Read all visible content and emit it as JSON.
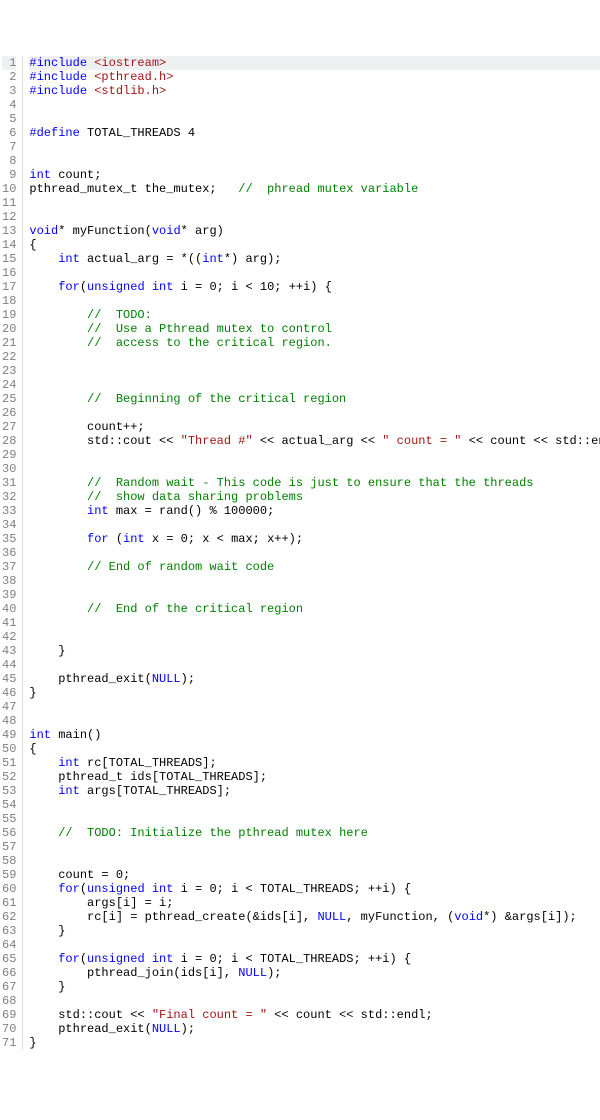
{
  "editor": {
    "currentLine": 1,
    "lines": [
      {
        "num": 1,
        "tokens": [
          {
            "cls": "pp",
            "t": "#include "
          },
          {
            "cls": "s",
            "t": "<iostream>"
          }
        ]
      },
      {
        "num": 2,
        "tokens": [
          {
            "cls": "pp",
            "t": "#include "
          },
          {
            "cls": "s",
            "t": "<pthread.h>"
          }
        ]
      },
      {
        "num": 3,
        "tokens": [
          {
            "cls": "pp",
            "t": "#include "
          },
          {
            "cls": "s",
            "t": "<stdlib.h>"
          }
        ]
      },
      {
        "num": 4,
        "tokens": []
      },
      {
        "num": 5,
        "tokens": []
      },
      {
        "num": 6,
        "tokens": [
          {
            "cls": "pp",
            "t": "#define "
          },
          {
            "cls": "n",
            "t": "TOTAL_THREADS "
          },
          {
            "cls": "m",
            "t": "4"
          }
        ]
      },
      {
        "num": 7,
        "tokens": []
      },
      {
        "num": 8,
        "tokens": []
      },
      {
        "num": 9,
        "tokens": [
          {
            "cls": "k",
            "t": "int"
          },
          {
            "cls": "n",
            "t": " count;"
          }
        ]
      },
      {
        "num": 10,
        "tokens": [
          {
            "cls": "n",
            "t": "pthread_mutex_t the_mutex;   "
          },
          {
            "cls": "c",
            "t": "//  phread mutex variable"
          }
        ]
      },
      {
        "num": 11,
        "tokens": []
      },
      {
        "num": 12,
        "tokens": []
      },
      {
        "num": 13,
        "tokens": [
          {
            "cls": "k",
            "t": "void"
          },
          {
            "cls": "n",
            "t": "* myFunction("
          },
          {
            "cls": "k",
            "t": "void"
          },
          {
            "cls": "n",
            "t": "* arg)"
          }
        ]
      },
      {
        "num": 14,
        "tokens": [
          {
            "cls": "n",
            "t": "{"
          }
        ]
      },
      {
        "num": 15,
        "tokens": [
          {
            "cls": "n",
            "t": "    "
          },
          {
            "cls": "k",
            "t": "int"
          },
          {
            "cls": "n",
            "t": " actual_arg = *(("
          },
          {
            "cls": "k",
            "t": "int"
          },
          {
            "cls": "n",
            "t": "*) arg);"
          }
        ]
      },
      {
        "num": 16,
        "tokens": []
      },
      {
        "num": 17,
        "tokens": [
          {
            "cls": "n",
            "t": "    "
          },
          {
            "cls": "k",
            "t": "for"
          },
          {
            "cls": "n",
            "t": "("
          },
          {
            "cls": "k",
            "t": "unsigned int"
          },
          {
            "cls": "n",
            "t": " i = "
          },
          {
            "cls": "m",
            "t": "0"
          },
          {
            "cls": "n",
            "t": "; i < "
          },
          {
            "cls": "m",
            "t": "10"
          },
          {
            "cls": "n",
            "t": "; ++i) {"
          }
        ]
      },
      {
        "num": 18,
        "tokens": []
      },
      {
        "num": 19,
        "tokens": [
          {
            "cls": "n",
            "t": "        "
          },
          {
            "cls": "c",
            "t": "//  TODO:"
          }
        ]
      },
      {
        "num": 20,
        "tokens": [
          {
            "cls": "n",
            "t": "        "
          },
          {
            "cls": "c",
            "t": "//  Use a Pthread mutex to control"
          }
        ]
      },
      {
        "num": 21,
        "tokens": [
          {
            "cls": "n",
            "t": "        "
          },
          {
            "cls": "c",
            "t": "//  access to the critical region."
          }
        ]
      },
      {
        "num": 22,
        "tokens": []
      },
      {
        "num": 23,
        "tokens": []
      },
      {
        "num": 24,
        "tokens": []
      },
      {
        "num": 25,
        "tokens": [
          {
            "cls": "n",
            "t": "        "
          },
          {
            "cls": "c",
            "t": "//  Beginning of the critical region"
          }
        ]
      },
      {
        "num": 26,
        "tokens": []
      },
      {
        "num": 27,
        "tokens": [
          {
            "cls": "n",
            "t": "        count++;"
          }
        ]
      },
      {
        "num": 28,
        "tokens": [
          {
            "cls": "n",
            "t": "        std::cout << "
          },
          {
            "cls": "s",
            "t": "\"Thread #\""
          },
          {
            "cls": "n",
            "t": " << actual_arg << "
          },
          {
            "cls": "s",
            "t": "\" count = \""
          },
          {
            "cls": "n",
            "t": " << count << std::endl;"
          }
        ]
      },
      {
        "num": 29,
        "tokens": []
      },
      {
        "num": 30,
        "tokens": []
      },
      {
        "num": 31,
        "tokens": [
          {
            "cls": "n",
            "t": "        "
          },
          {
            "cls": "c",
            "t": "//  Random wait - This code is just to ensure that the threads"
          }
        ]
      },
      {
        "num": 32,
        "tokens": [
          {
            "cls": "n",
            "t": "        "
          },
          {
            "cls": "c",
            "t": "//  show data sharing problems"
          }
        ]
      },
      {
        "num": 33,
        "tokens": [
          {
            "cls": "n",
            "t": "        "
          },
          {
            "cls": "k",
            "t": "int"
          },
          {
            "cls": "n",
            "t": " max = rand() % "
          },
          {
            "cls": "m",
            "t": "100000"
          },
          {
            "cls": "n",
            "t": ";"
          }
        ]
      },
      {
        "num": 34,
        "tokens": []
      },
      {
        "num": 35,
        "tokens": [
          {
            "cls": "n",
            "t": "        "
          },
          {
            "cls": "k",
            "t": "for"
          },
          {
            "cls": "n",
            "t": " ("
          },
          {
            "cls": "k",
            "t": "int"
          },
          {
            "cls": "n",
            "t": " x = "
          },
          {
            "cls": "m",
            "t": "0"
          },
          {
            "cls": "n",
            "t": "; x < max; x++);"
          }
        ]
      },
      {
        "num": 36,
        "tokens": []
      },
      {
        "num": 37,
        "tokens": [
          {
            "cls": "n",
            "t": "        "
          },
          {
            "cls": "c",
            "t": "// End of random wait code"
          }
        ]
      },
      {
        "num": 38,
        "tokens": []
      },
      {
        "num": 39,
        "tokens": []
      },
      {
        "num": 40,
        "tokens": [
          {
            "cls": "n",
            "t": "        "
          },
          {
            "cls": "c",
            "t": "//  End of the critical region"
          }
        ]
      },
      {
        "num": 41,
        "tokens": []
      },
      {
        "num": 42,
        "tokens": []
      },
      {
        "num": 43,
        "tokens": [
          {
            "cls": "n",
            "t": "    }"
          }
        ]
      },
      {
        "num": 44,
        "tokens": []
      },
      {
        "num": 45,
        "tokens": [
          {
            "cls": "n",
            "t": "    pthread_exit("
          },
          {
            "cls": "k",
            "t": "NULL"
          },
          {
            "cls": "n",
            "t": ");"
          }
        ]
      },
      {
        "num": 46,
        "tokens": [
          {
            "cls": "n",
            "t": "}"
          }
        ]
      },
      {
        "num": 47,
        "tokens": []
      },
      {
        "num": 48,
        "tokens": []
      },
      {
        "num": 49,
        "tokens": [
          {
            "cls": "k",
            "t": "int"
          },
          {
            "cls": "n",
            "t": " main()"
          }
        ]
      },
      {
        "num": 50,
        "tokens": [
          {
            "cls": "n",
            "t": "{"
          }
        ]
      },
      {
        "num": 51,
        "tokens": [
          {
            "cls": "n",
            "t": "    "
          },
          {
            "cls": "k",
            "t": "int"
          },
          {
            "cls": "n",
            "t": " rc[TOTAL_THREADS];"
          }
        ]
      },
      {
        "num": 52,
        "tokens": [
          {
            "cls": "n",
            "t": "    pthread_t ids[TOTAL_THREADS];"
          }
        ]
      },
      {
        "num": 53,
        "tokens": [
          {
            "cls": "n",
            "t": "    "
          },
          {
            "cls": "k",
            "t": "int"
          },
          {
            "cls": "n",
            "t": " args[TOTAL_THREADS];"
          }
        ]
      },
      {
        "num": 54,
        "tokens": []
      },
      {
        "num": 55,
        "tokens": []
      },
      {
        "num": 56,
        "tokens": [
          {
            "cls": "n",
            "t": "    "
          },
          {
            "cls": "c",
            "t": "//  TODO: Initialize the pthread mutex here"
          }
        ]
      },
      {
        "num": 57,
        "tokens": []
      },
      {
        "num": 58,
        "tokens": []
      },
      {
        "num": 59,
        "tokens": [
          {
            "cls": "n",
            "t": "    count = "
          },
          {
            "cls": "m",
            "t": "0"
          },
          {
            "cls": "n",
            "t": ";"
          }
        ]
      },
      {
        "num": 60,
        "tokens": [
          {
            "cls": "n",
            "t": "    "
          },
          {
            "cls": "k",
            "t": "for"
          },
          {
            "cls": "n",
            "t": "("
          },
          {
            "cls": "k",
            "t": "unsigned int"
          },
          {
            "cls": "n",
            "t": " i = "
          },
          {
            "cls": "m",
            "t": "0"
          },
          {
            "cls": "n",
            "t": "; i < TOTAL_THREADS; ++i) {"
          }
        ]
      },
      {
        "num": 61,
        "tokens": [
          {
            "cls": "n",
            "t": "        args[i] = i;"
          }
        ]
      },
      {
        "num": 62,
        "tokens": [
          {
            "cls": "n",
            "t": "        rc[i] = pthread_create(&ids[i], "
          },
          {
            "cls": "k",
            "t": "NULL"
          },
          {
            "cls": "n",
            "t": ", myFunction, ("
          },
          {
            "cls": "k",
            "t": "void"
          },
          {
            "cls": "n",
            "t": "*) &args[i]);"
          }
        ]
      },
      {
        "num": 63,
        "tokens": [
          {
            "cls": "n",
            "t": "    }"
          }
        ]
      },
      {
        "num": 64,
        "tokens": []
      },
      {
        "num": 65,
        "tokens": [
          {
            "cls": "n",
            "t": "    "
          },
          {
            "cls": "k",
            "t": "for"
          },
          {
            "cls": "n",
            "t": "("
          },
          {
            "cls": "k",
            "t": "unsigned int"
          },
          {
            "cls": "n",
            "t": " i = "
          },
          {
            "cls": "m",
            "t": "0"
          },
          {
            "cls": "n",
            "t": "; i < TOTAL_THREADS; ++i) {"
          }
        ]
      },
      {
        "num": 66,
        "tokens": [
          {
            "cls": "n",
            "t": "        pthread_join(ids[i], "
          },
          {
            "cls": "k",
            "t": "NULL"
          },
          {
            "cls": "n",
            "t": ");"
          }
        ]
      },
      {
        "num": 67,
        "tokens": [
          {
            "cls": "n",
            "t": "    }"
          }
        ]
      },
      {
        "num": 68,
        "tokens": []
      },
      {
        "num": 69,
        "tokens": [
          {
            "cls": "n",
            "t": "    std::cout << "
          },
          {
            "cls": "s",
            "t": "\"Final count = \""
          },
          {
            "cls": "n",
            "t": " << count << std::endl;"
          }
        ]
      },
      {
        "num": 70,
        "tokens": [
          {
            "cls": "n",
            "t": "    pthread_exit("
          },
          {
            "cls": "k",
            "t": "NULL"
          },
          {
            "cls": "n",
            "t": ");"
          }
        ]
      },
      {
        "num": 71,
        "tokens": [
          {
            "cls": "n",
            "t": "}"
          }
        ]
      }
    ]
  }
}
